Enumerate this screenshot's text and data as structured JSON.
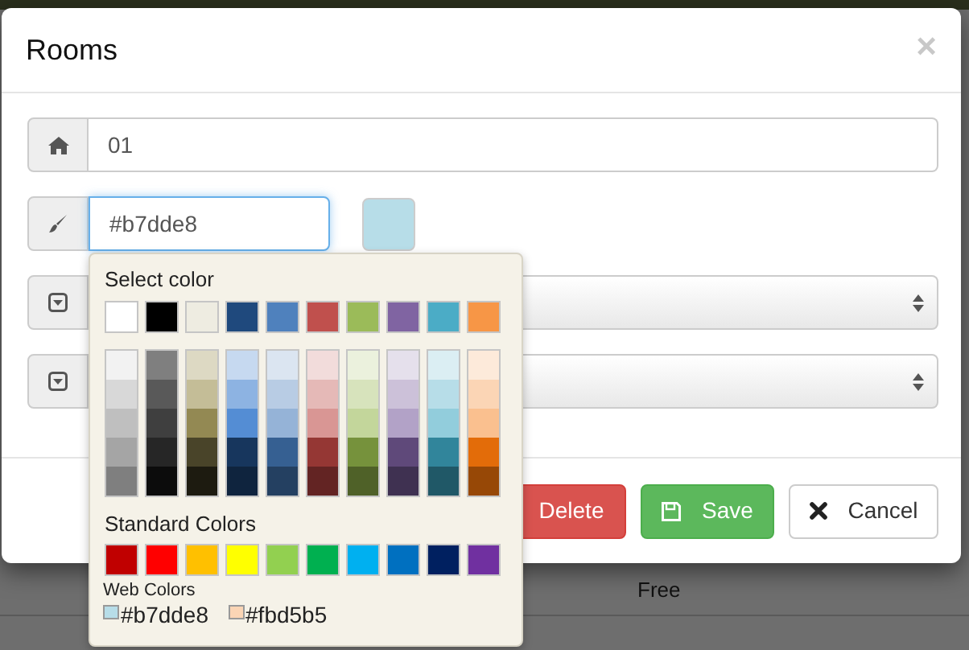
{
  "dialog": {
    "title": "Rooms",
    "close_label": "×",
    "fields": [
      {
        "kind": "text",
        "value": "01"
      },
      {
        "kind": "color",
        "value": "#b7dde8",
        "color": "#b7dde8"
      },
      {
        "kind": "select"
      },
      {
        "kind": "select"
      }
    ],
    "buttons": [
      {
        "kind": "delete",
        "label": "Delete"
      },
      {
        "kind": "save",
        "label": "Save"
      },
      {
        "kind": "cancel",
        "label": "Cancel"
      }
    ]
  },
  "color_picker": {
    "title": "Select color",
    "theme_colors": [
      {
        "color": "#ffffff"
      },
      {
        "color": "#000000"
      },
      {
        "color": "#eeece1"
      },
      {
        "color": "#1f497d"
      },
      {
        "color": "#4f81bd"
      },
      {
        "color": "#c0504d"
      },
      {
        "color": "#9bbb59"
      },
      {
        "color": "#8064a2"
      },
      {
        "color": "#4bacc6"
      },
      {
        "color": "#f79646"
      }
    ],
    "shade_columns": [
      {
        "shades": [
          {
            "color": "#f2f2f2"
          },
          {
            "color": "#d8d8d8"
          },
          {
            "color": "#bfbfbf"
          },
          {
            "color": "#a5a5a5"
          },
          {
            "color": "#7f7f7f"
          }
        ]
      },
      {
        "shades": [
          {
            "color": "#7f7f7f"
          },
          {
            "color": "#595959"
          },
          {
            "color": "#3f3f3f"
          },
          {
            "color": "#262626"
          },
          {
            "color": "#0c0c0c"
          }
        ]
      },
      {
        "shades": [
          {
            "color": "#ddd9c3"
          },
          {
            "color": "#c4bd97"
          },
          {
            "color": "#938953"
          },
          {
            "color": "#494429"
          },
          {
            "color": "#1d1b10"
          }
        ]
      },
      {
        "shades": [
          {
            "color": "#c6d9f0"
          },
          {
            "color": "#8db3e2"
          },
          {
            "color": "#548dd4"
          },
          {
            "color": "#17365d"
          },
          {
            "color": "#0f243e"
          }
        ]
      },
      {
        "shades": [
          {
            "color": "#dbe5f1"
          },
          {
            "color": "#b8cce4"
          },
          {
            "color": "#95b3d7"
          },
          {
            "color": "#366092"
          },
          {
            "color": "#244061"
          }
        ]
      },
      {
        "shades": [
          {
            "color": "#f2dcdb"
          },
          {
            "color": "#e5b9b7"
          },
          {
            "color": "#d99694"
          },
          {
            "color": "#953734"
          },
          {
            "color": "#632423"
          }
        ]
      },
      {
        "shades": [
          {
            "color": "#ebf1dd"
          },
          {
            "color": "#d7e3bc"
          },
          {
            "color": "#c3d69b"
          },
          {
            "color": "#76923c"
          },
          {
            "color": "#4f6128"
          }
        ]
      },
      {
        "shades": [
          {
            "color": "#e5e0ec"
          },
          {
            "color": "#ccc1d9"
          },
          {
            "color": "#b2a2c7"
          },
          {
            "color": "#5f497a"
          },
          {
            "color": "#3f3151"
          }
        ]
      },
      {
        "shades": [
          {
            "color": "#dbeef3"
          },
          {
            "color": "#b7dde8"
          },
          {
            "color": "#92cddc"
          },
          {
            "color": "#31859b"
          },
          {
            "color": "#205867"
          }
        ]
      },
      {
        "shades": [
          {
            "color": "#fdeada"
          },
          {
            "color": "#fbd5b5"
          },
          {
            "color": "#fac08f"
          },
          {
            "color": "#e36c09"
          },
          {
            "color": "#974806"
          }
        ]
      }
    ],
    "standard_title": "Standard Colors",
    "standard_colors": [
      {
        "color": "#c00000"
      },
      {
        "color": "#ff0000"
      },
      {
        "color": "#ffc000"
      },
      {
        "color": "#ffff00"
      },
      {
        "color": "#92d050"
      },
      {
        "color": "#00b050"
      },
      {
        "color": "#00b0f0"
      },
      {
        "color": "#0070c0"
      },
      {
        "color": "#002060"
      },
      {
        "color": "#7030a0"
      }
    ],
    "web_title": "Web Colors",
    "web_colors": [
      {
        "label": "#b7dde8",
        "color": "#b7dde8"
      },
      {
        "label": "#fbd5b5",
        "color": "#fbd5b5"
      }
    ]
  },
  "background": {
    "rows": [
      {
        "status": "Free"
      }
    ]
  }
}
